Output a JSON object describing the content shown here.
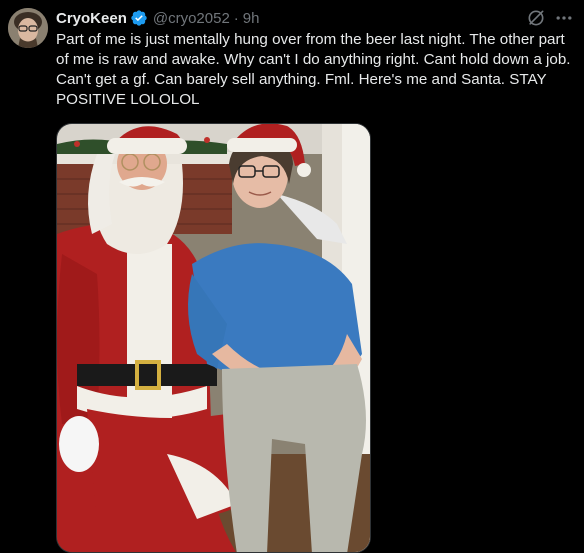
{
  "author": {
    "display_name": "CryoKeen",
    "handle": "@cryo2052",
    "time": "9h",
    "separator": "·",
    "verified": true,
    "avatar_icon": "profile-avatar"
  },
  "tweet": {
    "text": "Part of me is just mentally hung over from the beer last night. The other part of me is raw and awake. Why can't I do anything right. Cant hold down a job. Can't get a gf. Can barely sell anything. Fml. Here's me and Santa. STAY POSITIVE LOLOLOL"
  },
  "actions": {
    "grok_icon": "grok-icon",
    "more_icon": "more-dots-icon"
  },
  "colors": {
    "background": "#000000",
    "text": "#e7e9ea",
    "muted": "#71767b",
    "verified": "#1d9bf0"
  }
}
